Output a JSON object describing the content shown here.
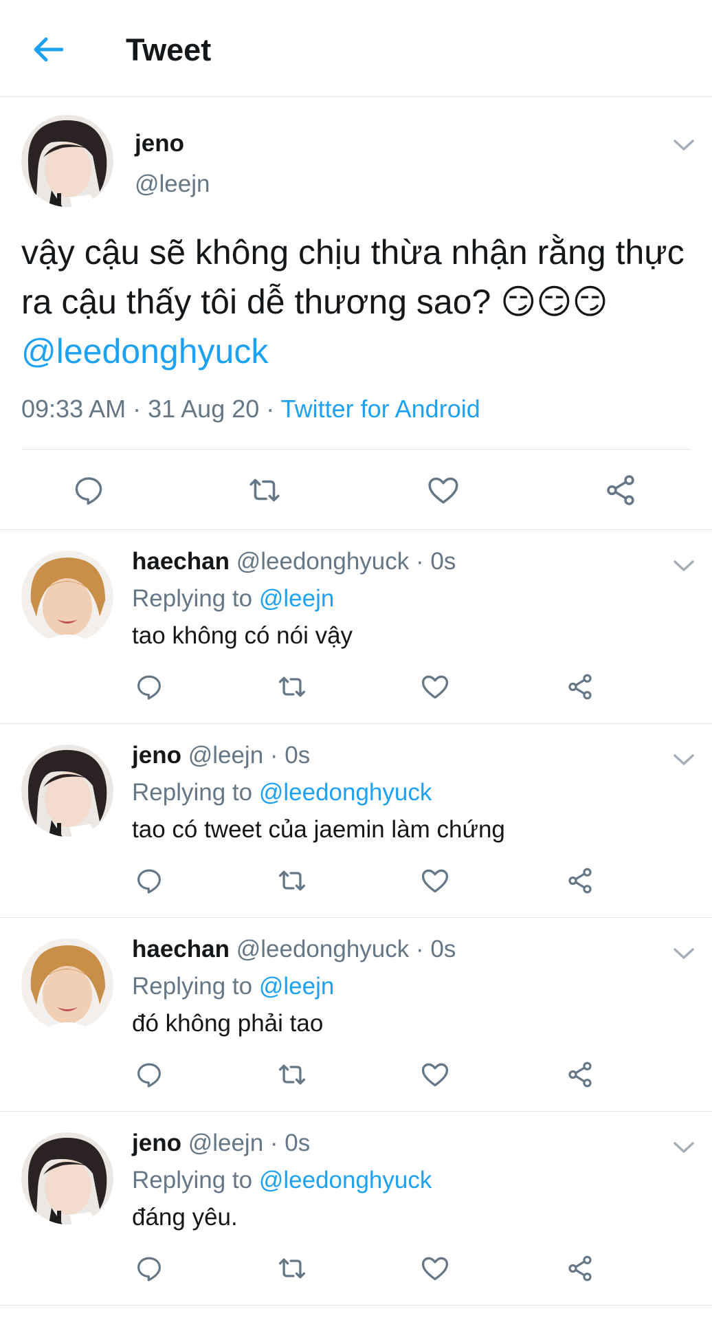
{
  "header": {
    "title": "Tweet",
    "back_icon": "arrow-left-icon"
  },
  "main_tweet": {
    "name": "jeno",
    "handle": "@leejn",
    "text": "vậy cậu sẽ không chịu thừa nhận rằng thực ra cậu thấy tôi dễ thương sao? 😏😏😏",
    "mention": "@leedonghyuck",
    "time": "09:33 AM · 31 Aug 20 · ",
    "source": "Twitter for Android"
  },
  "replies": [
    {
      "name": "haechan",
      "meta": "@leedonghyuck · 0s",
      "replying_prefix": "Replying to ",
      "replying_to": "@leejn",
      "text": "tao không có nói vậy"
    },
    {
      "name": "jeno",
      "meta": "@leejn · 0s",
      "replying_prefix": "Replying to ",
      "replying_to": "@leedonghyuck",
      "text": "tao có tweet của jaemin làm chứng"
    },
    {
      "name": "haechan",
      "meta": "@leedonghyuck · 0s",
      "replying_prefix": "Replying to ",
      "replying_to": "@leejn",
      "text": "đó không phải tao"
    },
    {
      "name": "jeno",
      "meta": "@leejn · 0s",
      "replying_prefix": "Replying to ",
      "replying_to": "@leedonghyuck",
      "text": "đáng yêu."
    }
  ],
  "colors": {
    "accent": "#1da1f2",
    "secondary_text": "#657786",
    "divider": "#e1e8ed",
    "icon": "#657786"
  }
}
